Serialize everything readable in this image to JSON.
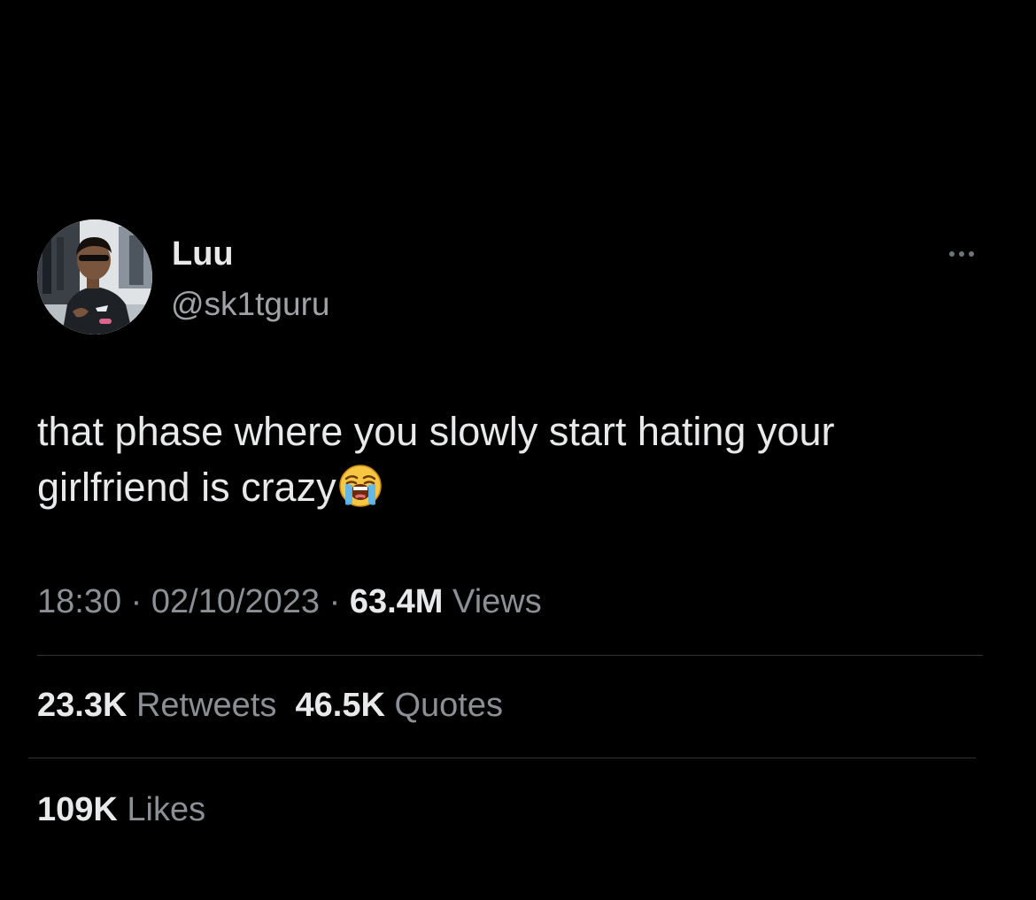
{
  "tweet": {
    "author": {
      "display_name": "Luu",
      "handle": "@sk1tguru"
    },
    "text_line1": "that phase where you slowly start hating your",
    "text_line2": "girlfriend is crazy",
    "emoji": "loudly-crying-face",
    "time": "18:30",
    "date": "02/10/2023",
    "separator": "·",
    "views_count": "63.4M",
    "views_label": "Views",
    "retweets_count": "23.3K",
    "retweets_label": "Retweets",
    "quotes_count": "46.5K",
    "quotes_label": "Quotes",
    "likes_count": "109K",
    "likes_label": "Likes"
  },
  "colors": {
    "background": "#000000",
    "primary_text": "#e7e9ea",
    "secondary_text": "#8b9096",
    "divider": "#2f3336"
  }
}
